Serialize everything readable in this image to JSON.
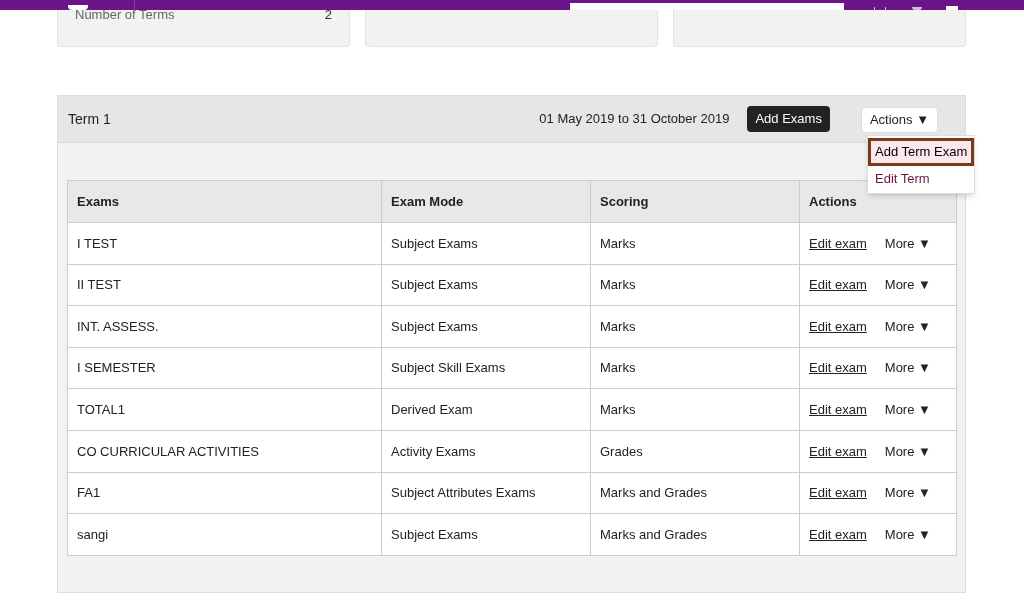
{
  "summary_cards": [
    {
      "label": "Number of Terms",
      "value": "2"
    }
  ],
  "term": {
    "name": "Term 1",
    "dates": "01 May 2019 to 31 October 2019",
    "add_button": "Add Exams",
    "actions_button": "Actions ▼",
    "actions_menu": [
      {
        "label": "Add Term Exam",
        "selected": true
      },
      {
        "label": "Edit Term",
        "selected": false
      }
    ]
  },
  "table": {
    "columns": [
      "Exams",
      "Exam Mode",
      "Scoring",
      "Actions"
    ],
    "rows": [
      {
        "exam": "I TEST",
        "mode": "Subject Exams",
        "scoring": "Marks",
        "edit": "Edit exam",
        "more": "More ▼"
      },
      {
        "exam": "II TEST",
        "mode": "Subject Exams",
        "scoring": "Marks",
        "edit": "Edit exam",
        "more": "More ▼"
      },
      {
        "exam": "INT. ASSESS.",
        "mode": "Subject Exams",
        "scoring": "Marks",
        "edit": "Edit exam",
        "more": "More ▼"
      },
      {
        "exam": "I SEMESTER",
        "mode": "Subject Skill Exams",
        "scoring": "Marks",
        "edit": "Edit exam",
        "more": "More ▼"
      },
      {
        "exam": "TOTAL1",
        "mode": "Derived Exam",
        "scoring": "Marks",
        "edit": "Edit exam",
        "more": "More ▼"
      },
      {
        "exam": "CO CURRICULAR ACTIVITIES",
        "mode": "Activity Exams",
        "scoring": "Grades",
        "edit": "Edit exam",
        "more": "More ▼"
      },
      {
        "exam": "FA1",
        "mode": "Subject Attributes Exams",
        "scoring": "Marks and Grades",
        "edit": "Edit exam",
        "more": "More ▼"
      },
      {
        "exam": "sangi",
        "mode": "Subject Exams",
        "scoring": "Marks and Grades",
        "edit": "Edit exam",
        "more": "More ▼"
      }
    ]
  }
}
